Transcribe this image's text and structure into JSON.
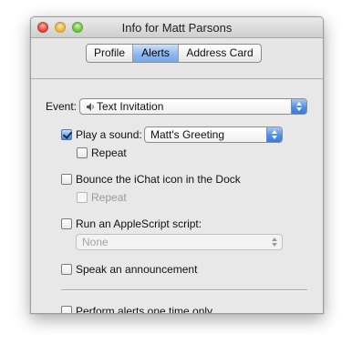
{
  "window": {
    "title": "Info for Matt Parsons"
  },
  "tabs": [
    {
      "label": "Profile",
      "selected": false
    },
    {
      "label": "Alerts",
      "selected": true
    },
    {
      "label": "Address Card",
      "selected": false
    }
  ],
  "event": {
    "label": "Event:",
    "value": "Text Invitation",
    "icon": "speaker-icon"
  },
  "play_sound": {
    "label": "Play a sound:",
    "checked": true,
    "sound_value": "Matt's Greeting",
    "repeat_label": "Repeat",
    "repeat_checked": false
  },
  "bounce": {
    "label": "Bounce the iChat icon in the Dock",
    "checked": false,
    "repeat_label": "Repeat",
    "repeat_enabled": false
  },
  "applescript": {
    "label": "Run an AppleScript script:",
    "checked": false,
    "script_value": "None",
    "script_enabled": false
  },
  "speak": {
    "label": "Speak an announcement",
    "checked": false
  },
  "perform_once": {
    "label": "Perform alerts one time only",
    "checked": false
  },
  "colors": {
    "accent": "#4f8fe6",
    "window_bg": "#e8e8e8"
  }
}
